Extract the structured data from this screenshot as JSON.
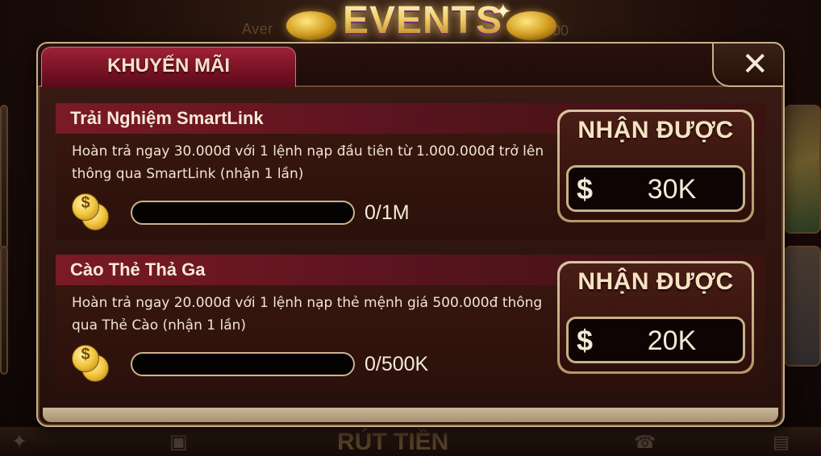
{
  "header": {
    "title": "EVENTS",
    "jackpot_left": "Aver",
    "jackpot_right": "0.000"
  },
  "dialog": {
    "tab_label": "KHUYẾN MÃI",
    "close_label": "✕"
  },
  "background": {
    "bottom_label": "RÚT TIỀN"
  },
  "events": [
    {
      "title": "Trải Nghiệm SmartLink",
      "description": "Hoàn trả ngay 30.000đ với 1 lệnh nạp đầu tiên từ 1.000.000đ trở lên thông qua SmartLink (nhận 1 lần)",
      "progress_text": "0/1M",
      "progress_fraction": 0,
      "reward_label": "NHẬN ĐƯỢC",
      "currency_symbol": "$",
      "reward_amount": "30K"
    },
    {
      "title": "Cào Thẻ Thả Ga",
      "description": "Hoàn trả ngay 20.000đ với 1 lệnh nạp thẻ mệnh giá 500.000đ thông qua Thẻ Cào (nhận 1 lần)",
      "progress_text": "0/500K",
      "progress_fraction": 0,
      "reward_label": "NHẬN ĐƯỢC",
      "currency_symbol": "$",
      "reward_amount": "20K"
    }
  ],
  "icons": {
    "coin": "coin-stack-icon",
    "dollar": "dollar-icon",
    "close": "close-icon"
  }
}
